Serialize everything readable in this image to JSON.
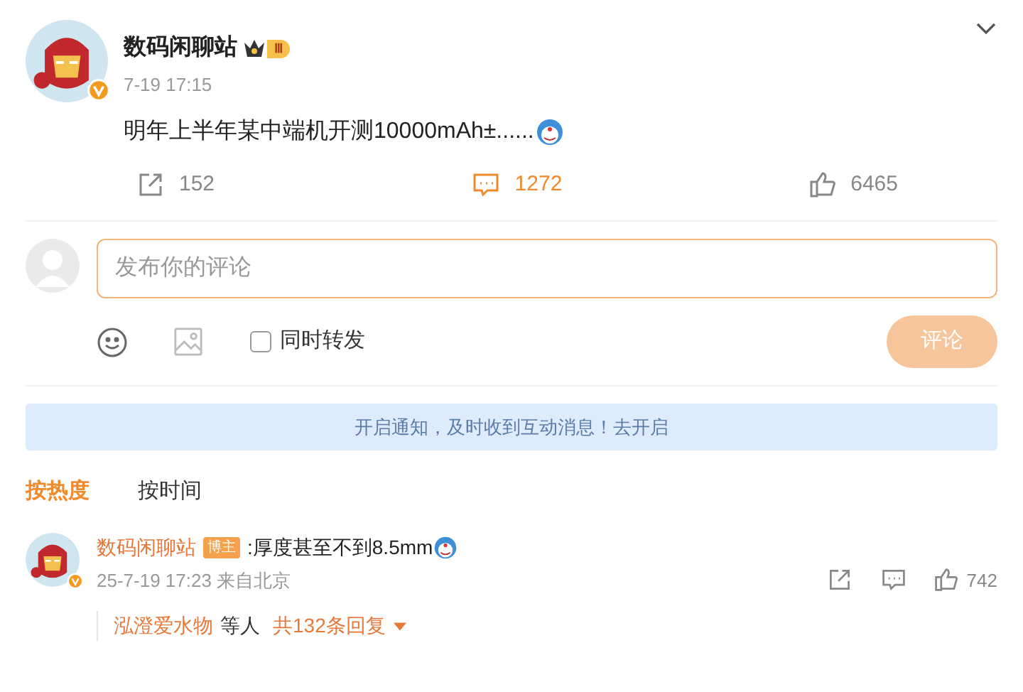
{
  "post": {
    "author": "数码闲聊站",
    "level_badge": "Ⅲ",
    "time": "7-19 17:15",
    "text": "明年上半年某中端机开测10000mAh±......",
    "actions": [
      {
        "kind": "share",
        "count": "152",
        "selected": false
      },
      {
        "kind": "comment",
        "count": "1272",
        "selected": true
      },
      {
        "kind": "like",
        "count": "6465",
        "selected": false
      }
    ]
  },
  "composer": {
    "placeholder": "发布你的评论",
    "repost": {
      "label": "同时转发",
      "checked": false
    },
    "submit": "评论"
  },
  "notice": "开启通知，及时收到互动消息！去开启",
  "sort_tabs": [
    {
      "label": "按热度",
      "selected": true
    },
    {
      "label": "按时间",
      "selected": false
    }
  ],
  "comments": [
    {
      "author": "数码闲聊站",
      "badge": "博主",
      "text": ":厚度甚至不到8.5mm",
      "time": "25-7-19 17:23 来自北京",
      "likes": "742",
      "reply_users": "泓澄爱水物",
      "reply_suffix": "等人",
      "reply_count": "共132条回复"
    }
  ]
}
